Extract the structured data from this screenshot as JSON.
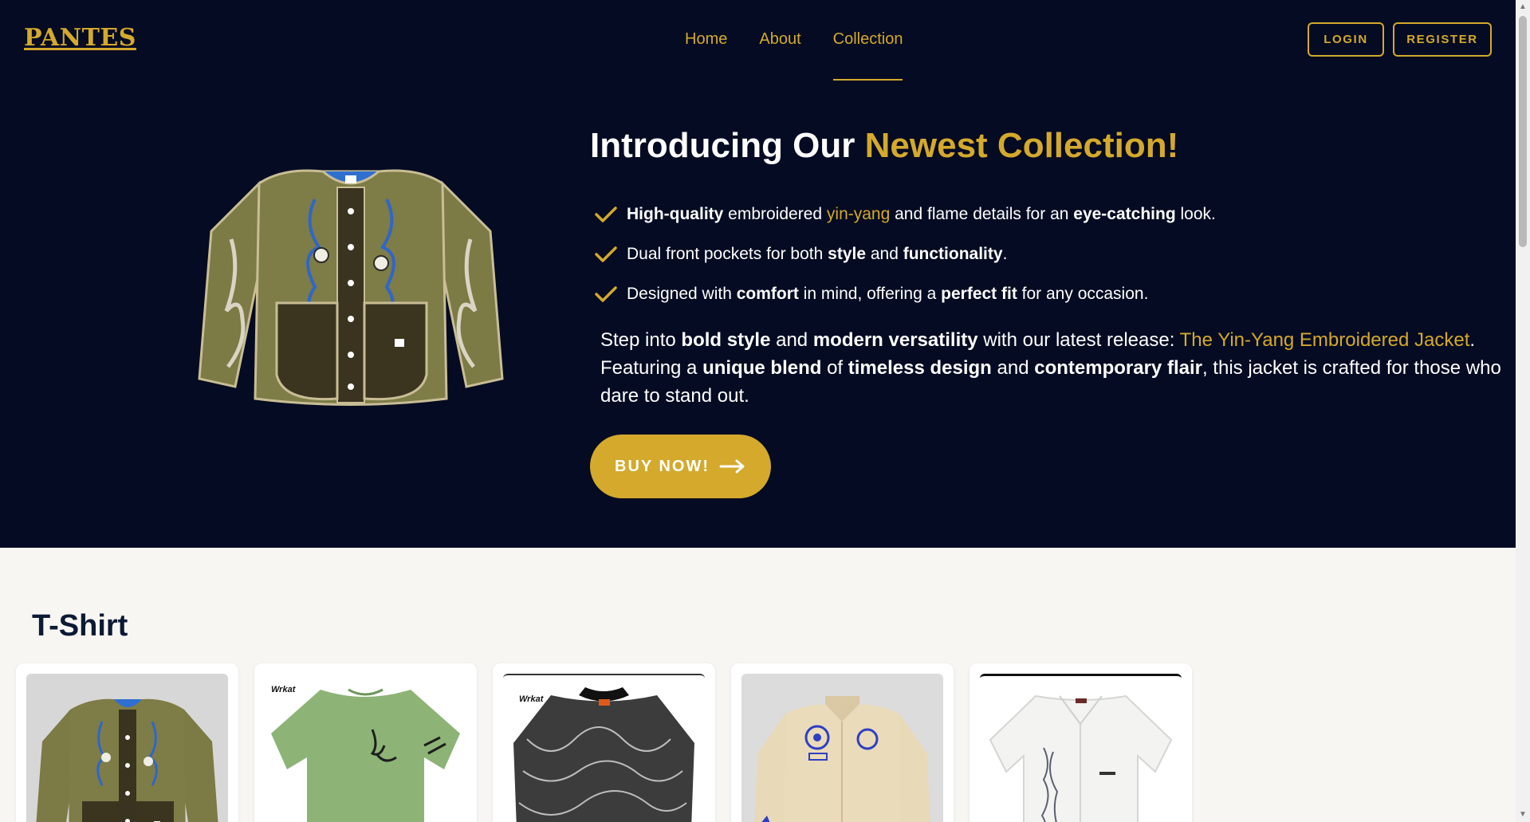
{
  "brand": {
    "logo": "PANTES"
  },
  "nav": {
    "items": [
      "Home",
      "About",
      "Collection"
    ],
    "active": "Collection"
  },
  "auth": {
    "login": "LOGIN",
    "register": "REGISTER"
  },
  "hero": {
    "title_start": "Introducing Our ",
    "title_accent": "Newest Collection!",
    "features": [
      {
        "b1": "High-quality",
        "t1": " embroidered ",
        "gold": "yin-yang",
        "t2": " and flame details for an ",
        "b2": "eye-catching",
        "t3": " look."
      },
      {
        "t1": "Dual front pockets for both ",
        "b1": "style",
        "t2": " and ",
        "b2": "functionality",
        "t3": "."
      },
      {
        "t1": "Designed with ",
        "b1": "comfort",
        "t2": " in mind, offering a ",
        "b2": "perfect fit",
        "t3": " for any occasion."
      }
    ],
    "description": {
      "t1": "Step into ",
      "b1": "bold style",
      "t2": " and ",
      "b2": "modern versatility",
      "t3": " with our latest release: ",
      "gold": "The Yin-Yang Embroidered Jacket",
      "t4": ". Featuring a ",
      "b3": "unique blend",
      "t5": " of ",
      "b4": "timeless design",
      "t6": " and ",
      "b5": "contemporary flair",
      "t7": ", this jacket is crafted for those who dare to stand out."
    },
    "cta": "BUY NOW!"
  },
  "collection": {
    "section_title": "T-Shirt",
    "products": [
      {
        "type": "jacket-olive",
        "brand_tag": ""
      },
      {
        "type": "tshirt-green",
        "brand_tag": "Wrkat"
      },
      {
        "type": "sweater-print",
        "brand_tag": "Wrkat"
      },
      {
        "type": "jacket-cream",
        "brand_tag": ""
      },
      {
        "type": "shirt-white",
        "brand_tag": ""
      }
    ]
  },
  "colors": {
    "navy": "#040b22",
    "gold": "#d4a92c",
    "page_bg": "#f7f6f2",
    "heading": "#0c1a34"
  }
}
